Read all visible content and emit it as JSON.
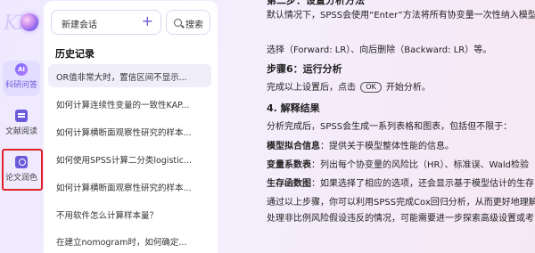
{
  "sidebar": {
    "items": [
      {
        "label": "科研问答",
        "icon": "ai-icon"
      },
      {
        "label": "文献阅读",
        "icon": "document-icon"
      },
      {
        "label": "论文润色",
        "icon": "paper-polish-icon"
      }
    ],
    "active_index": 0
  },
  "history": {
    "new_chat_label": "新建会话",
    "search_label": "搜索",
    "title": "历史记录",
    "items": [
      "OR值非常大时，置信区间不显示...",
      "如何计算连续性变量的一致性KAP...",
      "如何计算横断面观察性研究的样本...",
      "如何使用SPSS计算二分类logistic...",
      "如何计算横断面观察性研究的样本...",
      "不用软件怎么计算样本量？",
      "在建立nomogram时，如何确定..."
    ]
  },
  "content": {
    "line_cut": "第二步：设置分析方法",
    "line1": "默认情况下，SPSS会使用“Enter”方法将所有协变量一次性纳入模型",
    "line2": "选择（Forward: LR）、向后删除（Backward: LR）等。",
    "step6": "步骤6：运行分析",
    "run_pre": "完成以上设置后，点击",
    "run_btn": "OK",
    "run_post": "开始分析。",
    "section4": "4. 解释结果",
    "line3": "分析完成后，SPSS会生成一系列表格和图表，包括但不限于：",
    "fit_label": "模型拟合信息",
    "fit_text": "：提供关于模型整体性能的信息。",
    "coef_label": "变量系数表",
    "coef_text": "：列出每个协变量的风险比（HR）、标准误、Wald检验",
    "surv_label": "生存函数图",
    "surv_text": "：如果选择了相应的选项，还会显示基于模型估计的生存",
    "line4": "通过以上步骤，你可以利用SPSS完成Cox回归分析，从而更好地理解",
    "line5": "处理非比例风险假设违反的情况，可能需要进一步探索高级设置或考"
  }
}
